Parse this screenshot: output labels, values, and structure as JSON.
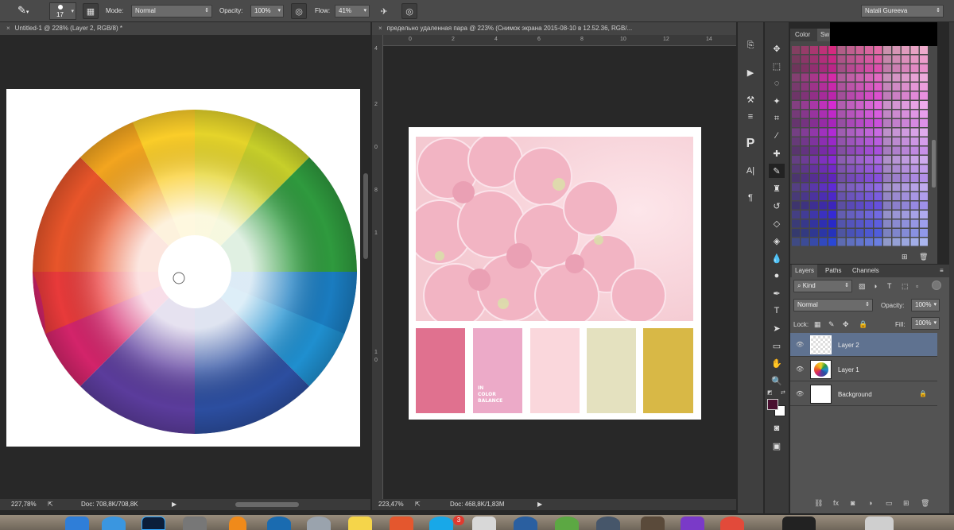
{
  "options_bar": {
    "brush_size": "17",
    "mode_label": "Mode:",
    "mode_value": "Normal",
    "opacity_label": "Opacity:",
    "opacity_value": "100%",
    "flow_label": "Flow:",
    "flow_value": "41%",
    "user_menu": "Natali Gureeva"
  },
  "doc_left": {
    "tab_title": "Untitled-1 @ 228% (Layer 2, RGB/8) *",
    "zoom": "227,78%",
    "doc_size": "Doc: 708,8K/708,8K"
  },
  "doc_right": {
    "tab_title": "предельно удаленная пара @ 223% (Снимок экрана 2015-08-10 в 12.52.36, RGB/...",
    "zoom": "223,47%",
    "doc_size": "Doc: 468,8K/1,83M",
    "ruler_top": [
      "0",
      "2",
      "4",
      "6",
      "8",
      "10",
      "12",
      "14"
    ],
    "ruler_left": [
      "4",
      "2",
      "0",
      "8",
      "1",
      "1",
      "0"
    ],
    "palette_caption": [
      "IN",
      "COLOR",
      "BALANCE"
    ],
    "palette_swatches": [
      "#e0718f",
      "#ecaac8",
      "#fad7dc",
      "#e4e1bf",
      "#d8b846"
    ]
  },
  "color_panel": {
    "tabs": [
      "Color",
      "Sw"
    ]
  },
  "layers_panel": {
    "tabs": [
      "Layers",
      "Paths",
      "Channels"
    ],
    "filter": "Kind",
    "blend_mode": "Normal",
    "opacity_label": "Opacity:",
    "opacity_value": "100%",
    "lock_label": "Lock:",
    "fill_label": "Fill:",
    "fill_value": "100%",
    "layers": [
      {
        "name": "Layer 2",
        "selected": true
      },
      {
        "name": "Layer 1",
        "selected": false
      },
      {
        "name": "Background",
        "selected": false,
        "locked": true
      }
    ]
  },
  "dock": {
    "badge": "3"
  },
  "colors": {
    "foreground": "#4a1030",
    "background": "#ffffff",
    "selection": "#5f7290"
  }
}
